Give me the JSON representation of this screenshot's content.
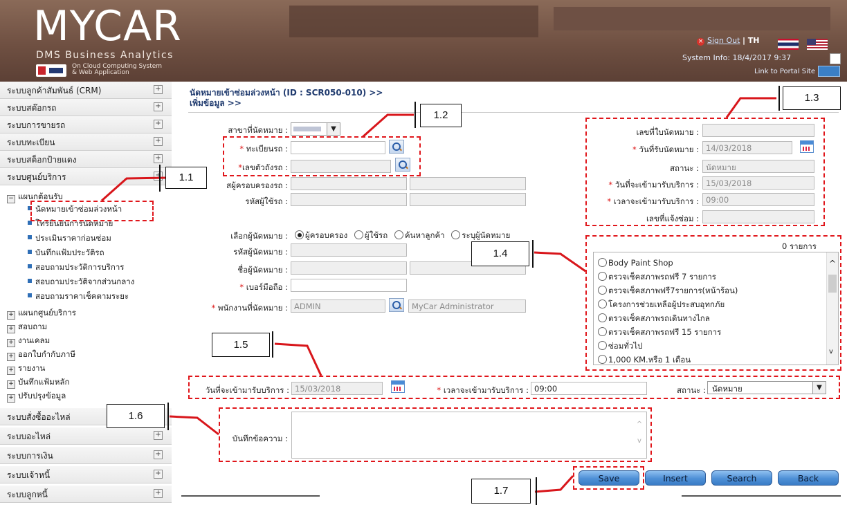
{
  "header": {
    "logo_main": "MYCAR",
    "logo_sub": "DMS Business Analytics",
    "logo_tag_1": "On Cloud Computing System",
    "logo_tag_2": "& Web Application",
    "sign_out": "Sign Out",
    "lang_sep": "| TH",
    "system_info": "System Info: 18/4/2017 9:37",
    "portal_link": "Link to Portal Site"
  },
  "sidebar": {
    "top_items": [
      {
        "label": "ระบบลูกค้าสัมพันธ์ (CRM)"
      },
      {
        "label": "ระบบสต๊อกรถ"
      },
      {
        "label": "ระบบการขายรถ"
      },
      {
        "label": "ระบบทะเบียน"
      },
      {
        "label": "ระบบสต็อกป้ายแดง"
      },
      {
        "label": "ระบบศูนย์บริการ"
      }
    ],
    "open_group": "แผนกต้อนรับ",
    "sub_items": [
      {
        "label": "นัดหมายเข้าซ่อมล่วงหน้า"
      },
      {
        "label": "โทรยืนยันการนัดหมาย"
      },
      {
        "label": "ประเมินราคาก่อนซ่อม"
      },
      {
        "label": "บันทึกแฟ้มประวัติรถ"
      },
      {
        "label": "สอบถามประวัติการบริการ"
      },
      {
        "label": "สอบถามประวัติจากส่วนกลาง"
      },
      {
        "label": "สอบถามราคาเช็คตามระยะ"
      }
    ],
    "groups": [
      {
        "label": "แผนกศูนย์บริการ"
      },
      {
        "label": "สอบถาม"
      },
      {
        "label": "งานเคลม"
      },
      {
        "label": "ออกใบกำกับภาษี"
      },
      {
        "label": "รายงาน"
      },
      {
        "label": "บันทึกแฟ้มหลัก"
      },
      {
        "label": "ปรับปรุงข้อมูล"
      }
    ],
    "bottom_items": [
      {
        "label": "ระบบสั่งซื้ออะไหล่"
      },
      {
        "label": "ระบบอะไหล่"
      },
      {
        "label": "ระบบการเงิน"
      },
      {
        "label": "ระบบเจ้าหนี้"
      },
      {
        "label": "ระบบลูกหนี้"
      }
    ]
  },
  "page": {
    "title_1": "นัดหมายเข้าซ่อมล่วงหน้า (ID : SCR050-010) >>",
    "title_2": "เพิ่มข้อมูล >>"
  },
  "form": {
    "branch_label": "สาขาที่นัดหมาย :",
    "plate_label": "ทะเบียนรถ :",
    "plate_value": "",
    "chassis_label": "เลขตัวถังรถ :",
    "owner_code_label": "สผู้ครอบครองรถ :",
    "user_code_label": "รหัสผู้ใช้รถ :",
    "choose_label": "เลือกผู้นัดหมาย :",
    "radio_owner": "ผู้ครอบครอง",
    "radio_user": "ผู้ใช้รถ",
    "radio_search": "ค้นหาลูกค้า",
    "radio_system": "ระบุผู้นัดหมาย",
    "appt_code_label": "รหัสผู้นัดหมาย :",
    "appt_name_label": "ชื่อผู้นัดหมาย :",
    "mobile_label": "เบอร์มือถือ :",
    "staff_label": "พนักงานที่นัดหมาย :",
    "staff_code": "ADMIN",
    "staff_name": "MyCar Administrator",
    "appt_no_label": "เลขที่ใบนัดหมาย :",
    "appt_date_label": "วันที่รับนัดหมาย :",
    "appt_date_value": "14/03/2018",
    "status_label": "สถานะ :",
    "status_value": "นัดหมาย",
    "service_date_label": "วันที่จะเข้ามารับบริการ :",
    "service_date_value": "15/03/2018",
    "service_time_label": "เวลาจะเข้ามารับบริการ :",
    "service_time_value": "09:00",
    "repair_no_label": "เลขที่แจ้งซ่อม :",
    "list_count": "0 รายการ",
    "list_items": [
      "Body Paint Shop",
      "ตรวจเช็คสภาพรถฟรี 7 รายการ",
      "ตรวจเช็คสภาพฟรี7รายการ(หน้าร้อน)",
      "โครงการช่วยเหลือผู้ประสบอุทกภัย",
      "ตรวจเช็คสภาพรถเดินทางไกล",
      "ตรวจเช็คสภาพรถฟรี 15 รายการ",
      "ซ่อมทั่วไป",
      "1,000 KM.หรือ 1 เดือน"
    ],
    "row_service_date_label": "วันที่จะเข้ามารับบริการ :",
    "row_service_date_value": "15/03/2018",
    "row_service_time_label": "เวลาจะเข้ามารับบริการ :",
    "row_service_time_value": "09:00",
    "row_status_label": "สถานะ :",
    "row_status_value": "นัดหมาย",
    "note_label": "บันทึกข้อความ :",
    "note_value": ""
  },
  "buttons": {
    "save": "Save",
    "insert": "Insert",
    "search": "Search",
    "back": "Back"
  },
  "callouts": {
    "c11": "1.1",
    "c12": "1.2",
    "c13": "1.3",
    "c14": "1.4",
    "c15": "1.5",
    "c16": "1.6",
    "c17": "1.7"
  },
  "colors": {
    "header_bg": "#6f5042",
    "title_color": "#1f3a6e",
    "required": "#d11111",
    "annotation": "#e0161b"
  }
}
